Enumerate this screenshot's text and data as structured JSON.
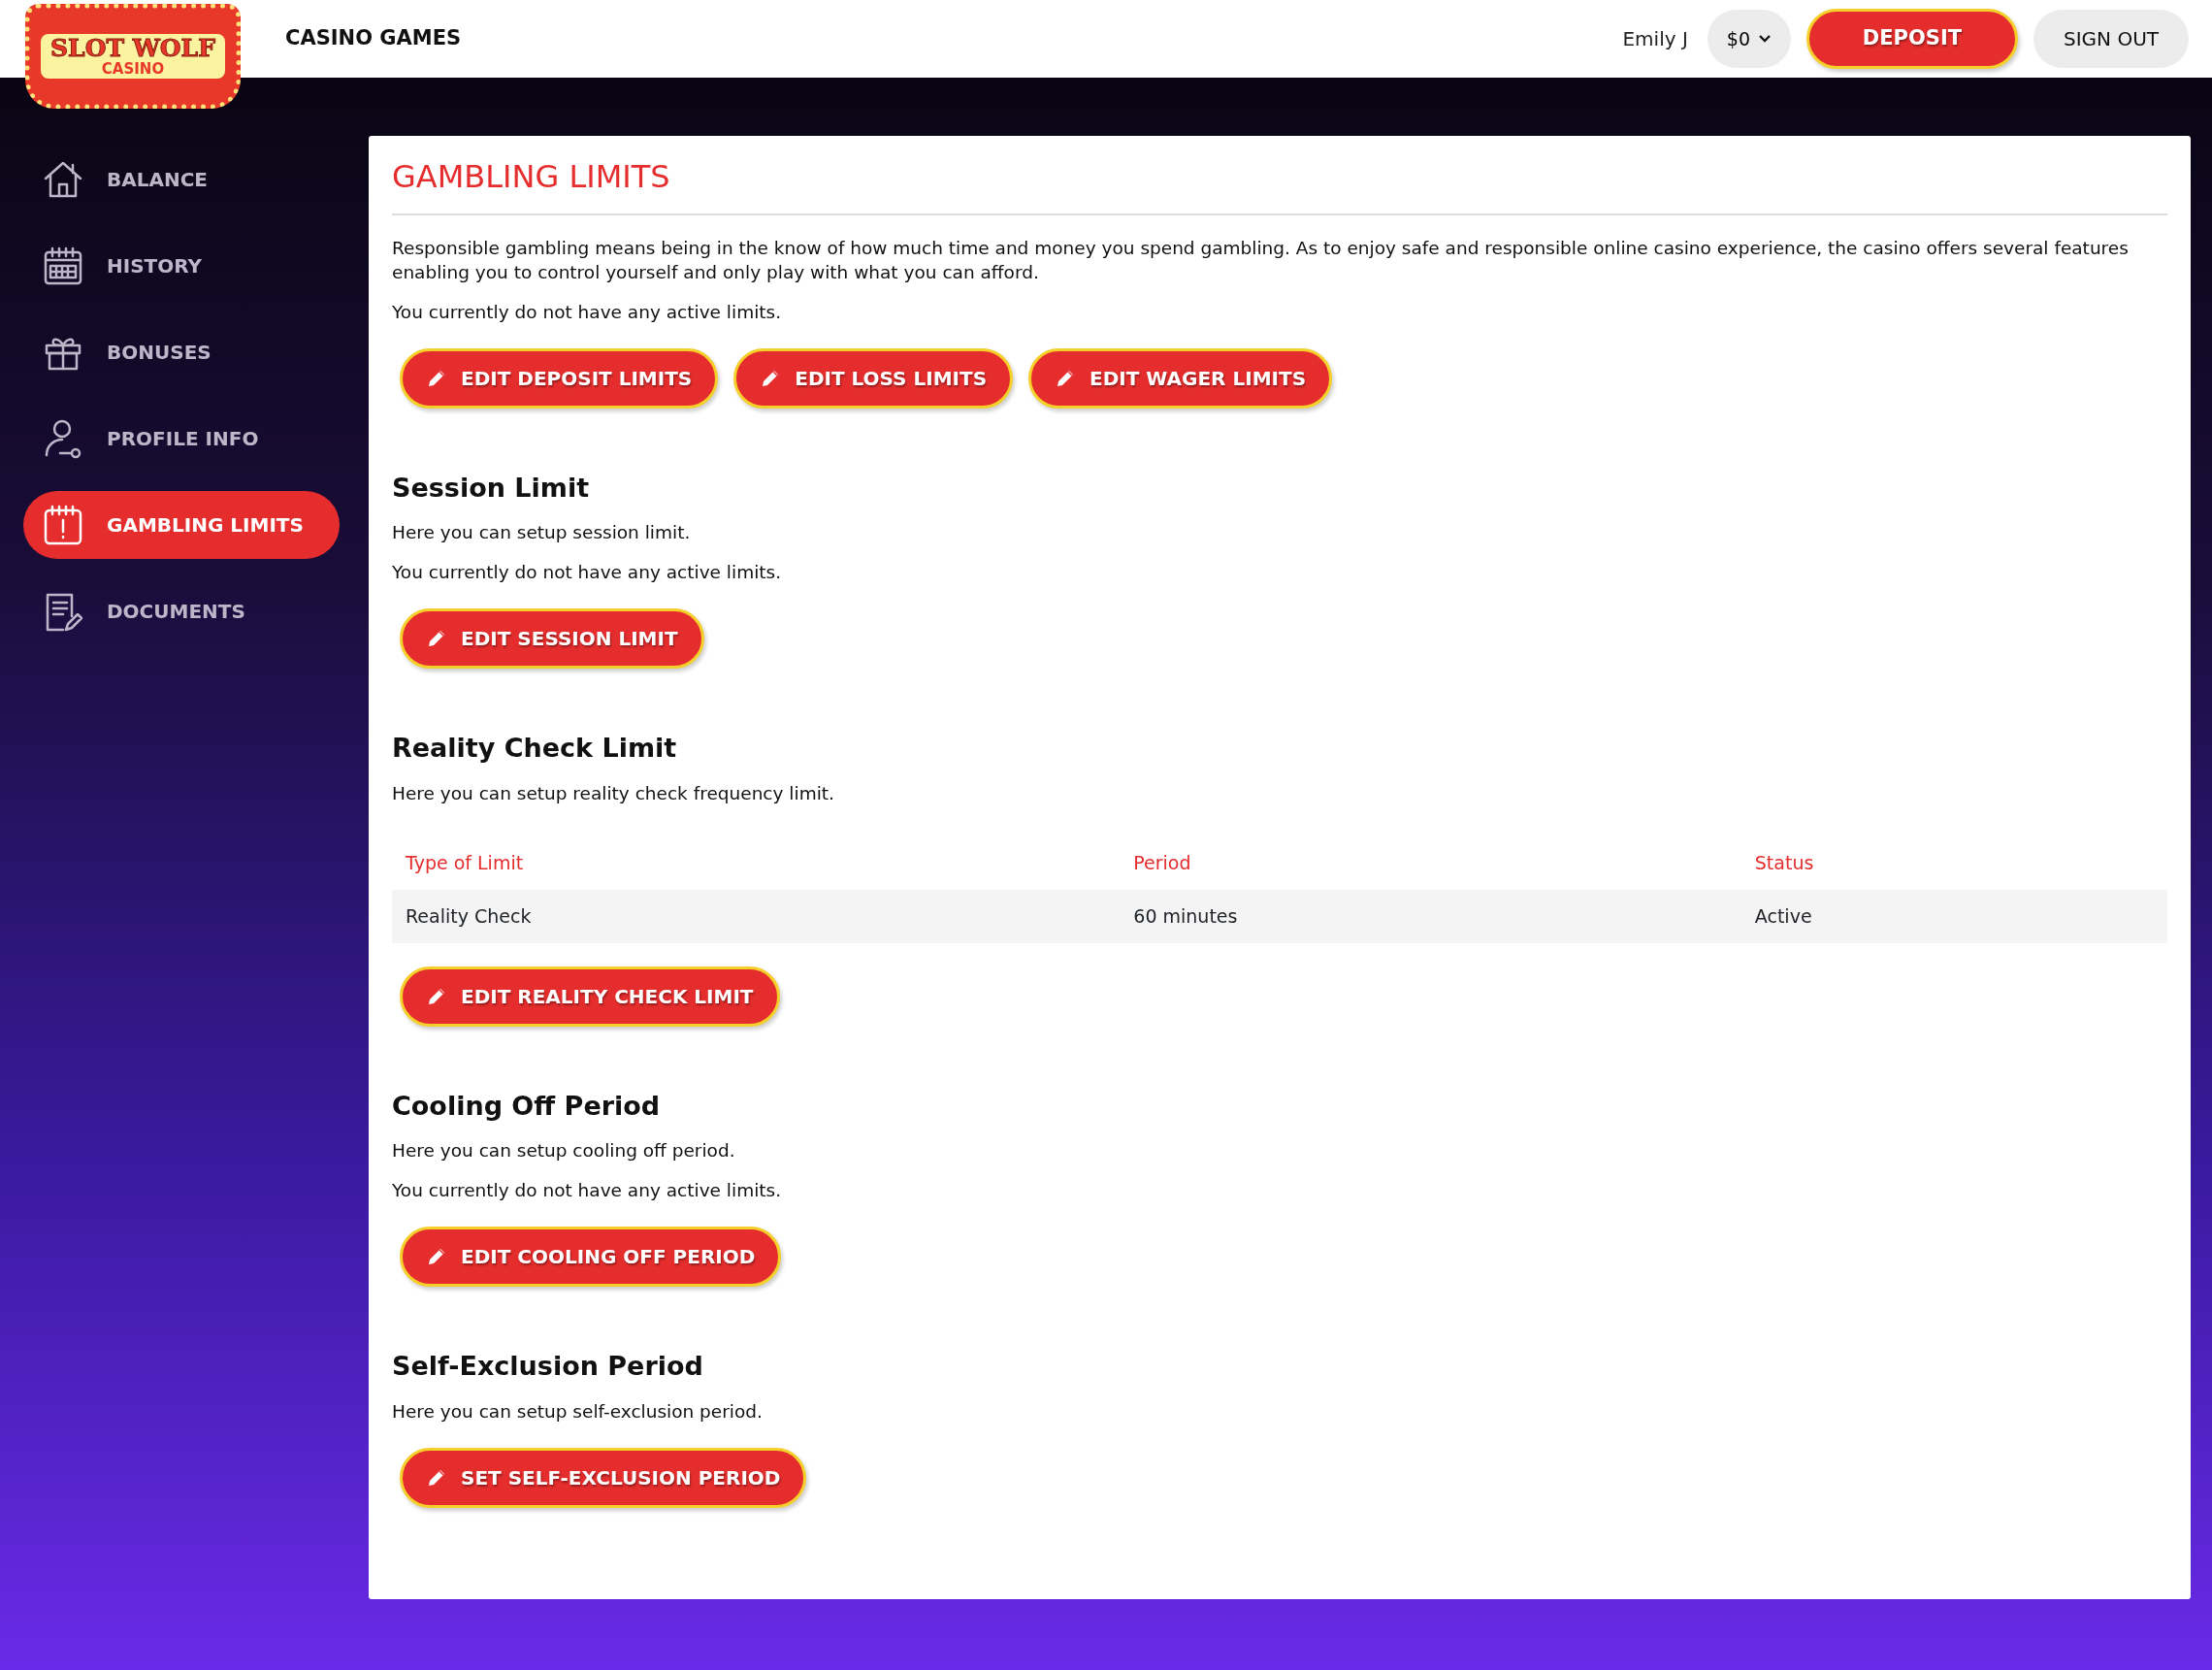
{
  "header": {
    "logo": {
      "title": "SLOT WOLF",
      "subtitle": "CASINO"
    },
    "nav_link": "CASINO GAMES",
    "user": "Emily J",
    "balance": "$0",
    "deposit_button": "DEPOSIT",
    "sign_out_button": "SIGN OUT"
  },
  "sidebar": {
    "items": [
      {
        "label": "BALANCE",
        "selected": false
      },
      {
        "label": "HISTORY",
        "selected": false
      },
      {
        "label": "BONUSES",
        "selected": false
      },
      {
        "label": "PROFILE INFO",
        "selected": false
      },
      {
        "label": "GAMBLING LIMITS",
        "selected": true
      },
      {
        "label": "DOCUMENTS",
        "selected": false
      }
    ]
  },
  "page_title": "GAMBLING LIMITS",
  "sections": [
    {
      "paragraphs": [
        "Responsible gambling means being in the know of how much time and money you spend gambling. As to enjoy safe and responsible online casino experience, the casino offers several features enabling you to control yourself and only play with what you can afford.",
        "You currently do not have any active limits."
      ],
      "buttons": [
        "EDIT DEPOSIT LIMITS",
        "EDIT LOSS LIMITS",
        "EDIT WAGER LIMITS"
      ]
    },
    {
      "title": "Session Limit",
      "paragraphs": [
        "Here you can setup session limit.",
        "You currently do not have any active limits."
      ],
      "buttons": [
        "EDIT SESSION LIMIT"
      ]
    },
    {
      "title": "Reality Check Limit",
      "paragraphs": [
        "Here you can setup reality check frequency limit."
      ],
      "table": {
        "columns": [
          "Type of Limit",
          "Period",
          "Status"
        ],
        "rows": [
          [
            "Reality Check",
            "60 minutes",
            "Active"
          ]
        ]
      },
      "buttons": [
        "EDIT REALITY CHECK LIMIT"
      ]
    },
    {
      "title": "Cooling Off Period",
      "paragraphs": [
        "Here you can setup cooling off period.",
        "You currently do not have any active limits."
      ],
      "buttons": [
        "EDIT COOLING OFF PERIOD"
      ]
    },
    {
      "title": "Self-Exclusion Period",
      "paragraphs": [
        "Here you can setup self-exclusion period."
      ],
      "buttons": [
        "SET SELF-EXCLUSION PERIOD"
      ]
    }
  ]
}
